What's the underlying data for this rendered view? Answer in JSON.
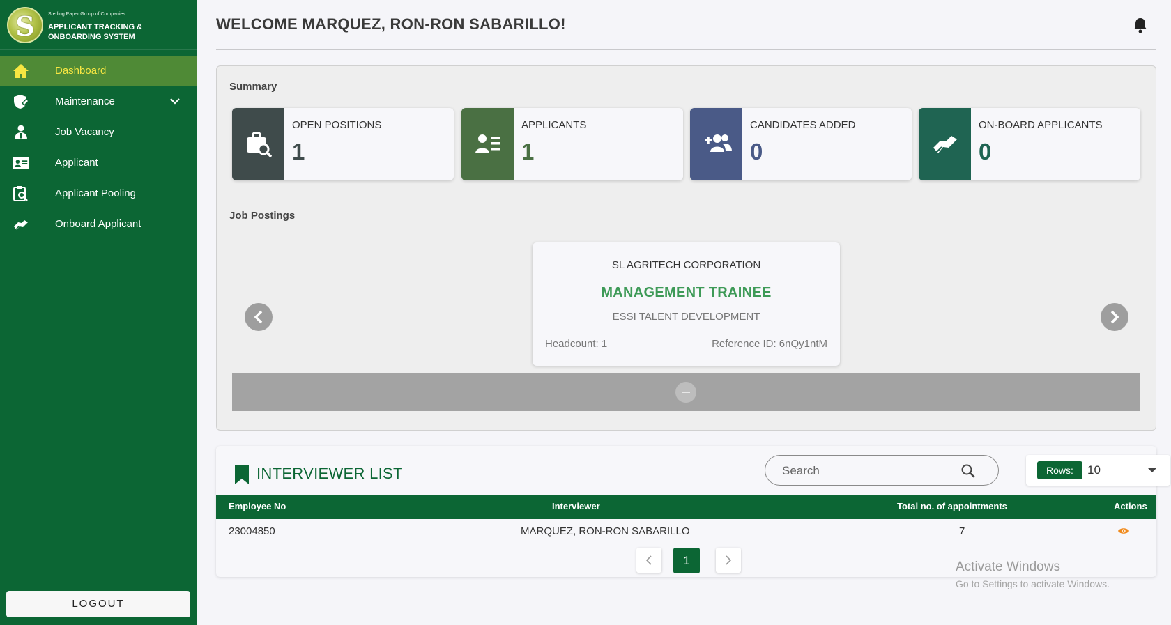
{
  "brand": {
    "subtitle": "Sterling Paper Group of Companies",
    "title_line1": "APPLICANT TRACKING &",
    "title_line2": "ONBOARDING SYSTEM",
    "logo_letter": "S"
  },
  "sidebar": {
    "items": [
      {
        "label": "Dashboard",
        "icon": "home-icon",
        "active": true
      },
      {
        "label": "Maintenance",
        "icon": "shield-icon",
        "active": false
      },
      {
        "label": "Job Vacancy",
        "icon": "person-tie-icon",
        "active": false
      },
      {
        "label": "Applicant",
        "icon": "id-card-icon",
        "active": false
      },
      {
        "label": "Applicant Pooling",
        "icon": "clipboard-search-icon",
        "active": false
      },
      {
        "label": "Onboard Applicant",
        "icon": "handshake-icon",
        "active": false
      }
    ],
    "logout_label": "LOGOUT"
  },
  "header": {
    "welcome": "WELCOME MARQUEZ, RON-RON SABARILLO!"
  },
  "summary": {
    "title": "Summary",
    "cards": [
      {
        "label": "OPEN POSITIONS",
        "value": "1",
        "color": "#3f4b4b",
        "value_color": "#3f4b4b"
      },
      {
        "label": "APPLICANTS",
        "value": "1",
        "color": "#4a7043",
        "value_color": "#4a7043"
      },
      {
        "label": "CANDIDATES ADDED",
        "value": "0",
        "color": "#4a5a87",
        "value_color": "#4a5a87"
      },
      {
        "label": "ON-BOARD APPLICANTS",
        "value": "0",
        "color": "#1f6452",
        "value_color": "#1f6452"
      }
    ]
  },
  "job_postings": {
    "title": "Job Postings",
    "company": "SL AGRITECH CORPORATION",
    "position": "MANAGEMENT TRAINEE",
    "department": "ESSI TALENT DEVELOPMENT",
    "headcount": "Headcount: 1",
    "reference": "Reference ID: 6nQy1ntM"
  },
  "interviewer_list": {
    "title": "INTERVIEWER LIST",
    "search_placeholder": "Search",
    "rows_label": "Rows:",
    "rows_value": "10",
    "columns": [
      "Employee No",
      "Interviewer",
      "Total no. of appointments",
      "Actions"
    ],
    "rows": [
      {
        "employee_no": "23004850",
        "interviewer": "MARQUEZ, RON-RON SABARILLO",
        "appointments": "7"
      }
    ],
    "current_page": "1"
  },
  "watermark": {
    "line1": "Activate Windows",
    "line2": "Go to Settings to activate Windows."
  },
  "colors": {
    "sidebar": "#0c6634",
    "active_item": "#4f8a36",
    "active_text": "#f7e642",
    "accent": "#0c6634",
    "action_eye": "#f08a1c"
  }
}
